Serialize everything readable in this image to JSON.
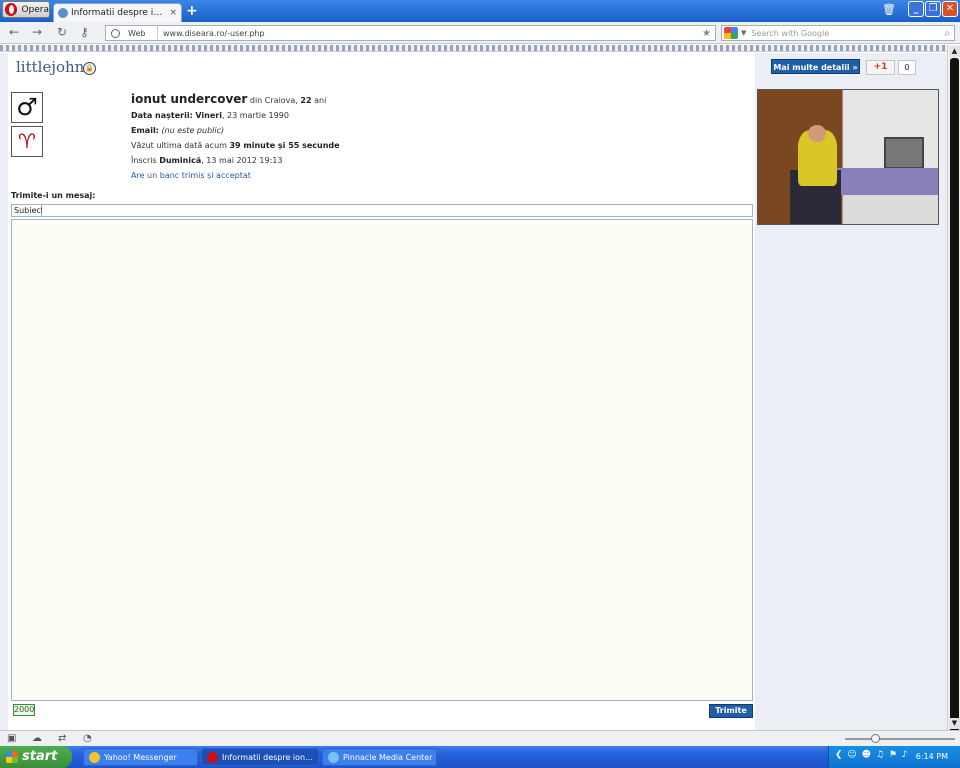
{
  "browser": {
    "menu_label": "Opera",
    "tab_title": "Informatii despre ionut u...",
    "tab_close": "×",
    "new_tab": "+",
    "address": {
      "scheme_label": "Web",
      "url": "www.diseara.ro/-user.php"
    },
    "search": {
      "placeholder": "Search with Google"
    }
  },
  "page": {
    "username": "littlejohn",
    "more_details_label": "Mai multe detalii »",
    "gplus_label": "+1",
    "gplus_count": "0",
    "profile": {
      "name": "ionut undercover",
      "from_prefix": " din Craiova, ",
      "age": "22",
      "age_suffix": " ani",
      "birth_label": "Data nașterii:",
      "birth_day": "Vineri",
      "birth_date": ", 23 martie 1990",
      "email_label": "Email:",
      "email_value": "(nu este public)",
      "last_seen_prefix": "Văzut ultima dată acum ",
      "last_seen_value": "39 minute și 55 secunde",
      "joined_prefix": "Înscris ",
      "joined_day": "Duminică",
      "joined_date": ", 13 mai 2012 19:13",
      "joke_link": "Are un banc trimis și acceptat"
    },
    "message": {
      "heading": "Trimite-i un mesaj:",
      "subject_label": "Subiect",
      "subject_value": "",
      "body_value": "",
      "char_counter": "2000",
      "send_label": "Trimite"
    }
  },
  "taskbar": {
    "start_label": "start",
    "tasks": [
      {
        "label": "Yahoo! Messenger"
      },
      {
        "label": "Informatii despre ion..."
      },
      {
        "label": "Pinnacle Media Center"
      }
    ],
    "clock": "6:14 PM"
  },
  "icons": {
    "gender": "male-icon",
    "zodiac": "aries-icon",
    "lock": "lock-icon"
  },
  "colors": {
    "button_blue": "#1f5fa6",
    "username": "#3d5a80",
    "link": "#2a5a9a",
    "taskbar": "#245edb",
    "start_green": "#3a8e3a"
  }
}
